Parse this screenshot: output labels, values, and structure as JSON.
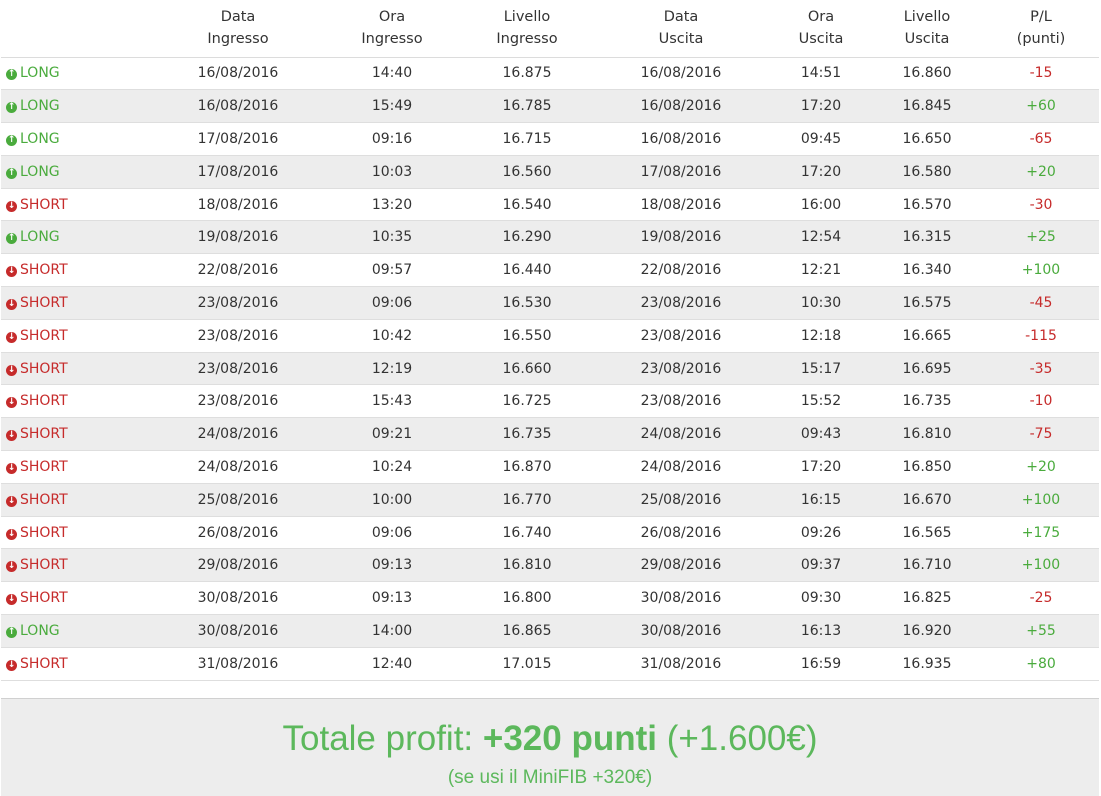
{
  "table": {
    "headers": [
      {
        "line1": "",
        "line2": ""
      },
      {
        "line1": "Data",
        "line2": "Ingresso"
      },
      {
        "line1": "Ora",
        "line2": "Ingresso"
      },
      {
        "line1": "Livello",
        "line2": "Ingresso"
      },
      {
        "line1": "Data",
        "line2": "Uscita"
      },
      {
        "line1": "Ora",
        "line2": "Uscita"
      },
      {
        "line1": "Livello",
        "line2": "Uscita"
      },
      {
        "line1": "P/L",
        "line2": "(punti)"
      }
    ],
    "rows": [
      {
        "direction": "LONG",
        "entry_date": "16/08/2016",
        "entry_time": "14:40",
        "entry_level": "16.875",
        "exit_date": "16/08/2016",
        "exit_time": "14:51",
        "exit_level": "16.860",
        "pl": "-15"
      },
      {
        "direction": "LONG",
        "entry_date": "16/08/2016",
        "entry_time": "15:49",
        "entry_level": "16.785",
        "exit_date": "16/08/2016",
        "exit_time": "17:20",
        "exit_level": "16.845",
        "pl": "+60"
      },
      {
        "direction": "LONG",
        "entry_date": "17/08/2016",
        "entry_time": "09:16",
        "entry_level": "16.715",
        "exit_date": "16/08/2016",
        "exit_time": "09:45",
        "exit_level": "16.650",
        "pl": "-65"
      },
      {
        "direction": "LONG",
        "entry_date": "17/08/2016",
        "entry_time": "10:03",
        "entry_level": "16.560",
        "exit_date": "17/08/2016",
        "exit_time": "17:20",
        "exit_level": "16.580",
        "pl": "+20"
      },
      {
        "direction": "SHORT",
        "entry_date": "18/08/2016",
        "entry_time": "13:20",
        "entry_level": "16.540",
        "exit_date": "18/08/2016",
        "exit_time": "16:00",
        "exit_level": "16.570",
        "pl": "-30"
      },
      {
        "direction": "LONG",
        "entry_date": "19/08/2016",
        "entry_time": "10:35",
        "entry_level": "16.290",
        "exit_date": "19/08/2016",
        "exit_time": "12:54",
        "exit_level": "16.315",
        "pl": "+25"
      },
      {
        "direction": "SHORT",
        "entry_date": "22/08/2016",
        "entry_time": "09:57",
        "entry_level": "16.440",
        "exit_date": "22/08/2016",
        "exit_time": "12:21",
        "exit_level": "16.340",
        "pl": "+100"
      },
      {
        "direction": "SHORT",
        "entry_date": "23/08/2016",
        "entry_time": "09:06",
        "entry_level": "16.530",
        "exit_date": "23/08/2016",
        "exit_time": "10:30",
        "exit_level": "16.575",
        "pl": "-45"
      },
      {
        "direction": "SHORT",
        "entry_date": "23/08/2016",
        "entry_time": "10:42",
        "entry_level": "16.550",
        "exit_date": "23/08/2016",
        "exit_time": "12:18",
        "exit_level": "16.665",
        "pl": "-115"
      },
      {
        "direction": "SHORT",
        "entry_date": "23/08/2016",
        "entry_time": "12:19",
        "entry_level": "16.660",
        "exit_date": "23/08/2016",
        "exit_time": "15:17",
        "exit_level": "16.695",
        "pl": "-35"
      },
      {
        "direction": "SHORT",
        "entry_date": "23/08/2016",
        "entry_time": "15:43",
        "entry_level": "16.725",
        "exit_date": "23/08/2016",
        "exit_time": "15:52",
        "exit_level": "16.735",
        "pl": "-10"
      },
      {
        "direction": "SHORT",
        "entry_date": "24/08/2016",
        "entry_time": "09:21",
        "entry_level": "16.735",
        "exit_date": "24/08/2016",
        "exit_time": "09:43",
        "exit_level": "16.810",
        "pl": "-75"
      },
      {
        "direction": "SHORT",
        "entry_date": "24/08/2016",
        "entry_time": "10:24",
        "entry_level": "16.870",
        "exit_date": "24/08/2016",
        "exit_time": "17:20",
        "exit_level": "16.850",
        "pl": "+20"
      },
      {
        "direction": "SHORT",
        "entry_date": "25/08/2016",
        "entry_time": "10:00",
        "entry_level": "16.770",
        "exit_date": "25/08/2016",
        "exit_time": "16:15",
        "exit_level": "16.670",
        "pl": "+100"
      },
      {
        "direction": "SHORT",
        "entry_date": "26/08/2016",
        "entry_time": "09:06",
        "entry_level": "16.740",
        "exit_date": "26/08/2016",
        "exit_time": "09:26",
        "exit_level": "16.565",
        "pl": "+175"
      },
      {
        "direction": "SHORT",
        "entry_date": "29/08/2016",
        "entry_time": "09:13",
        "entry_level": "16.810",
        "exit_date": "29/08/2016",
        "exit_time": "09:37",
        "exit_level": "16.710",
        "pl": "+100"
      },
      {
        "direction": "SHORT",
        "entry_date": "30/08/2016",
        "entry_time": "09:13",
        "entry_level": "16.800",
        "exit_date": "30/08/2016",
        "exit_time": "09:30",
        "exit_level": "16.825",
        "pl": "-25"
      },
      {
        "direction": "LONG",
        "entry_date": "30/08/2016",
        "entry_time": "14:00",
        "entry_level": "16.865",
        "exit_date": "30/08/2016",
        "exit_time": "16:13",
        "exit_level": "16.920",
        "pl": "+55"
      },
      {
        "direction": "SHORT",
        "entry_date": "31/08/2016",
        "entry_time": "12:40",
        "entry_level": "17.015",
        "exit_date": "31/08/2016",
        "exit_time": "16:59",
        "exit_level": "16.935",
        "pl": "+80"
      }
    ]
  },
  "icons": {
    "long": "arrow-circle-up-icon",
    "short": "arrow-circle-down-icon"
  },
  "colors": {
    "long": "#4aab3d",
    "short": "#c62b2b",
    "total": "#5cb85c"
  },
  "total": {
    "prefix": "Totale profit: ",
    "points": "+320 punti",
    "euro": " (+1.600€)",
    "subtitle": "(se usi il MiniFIB +320€)"
  }
}
